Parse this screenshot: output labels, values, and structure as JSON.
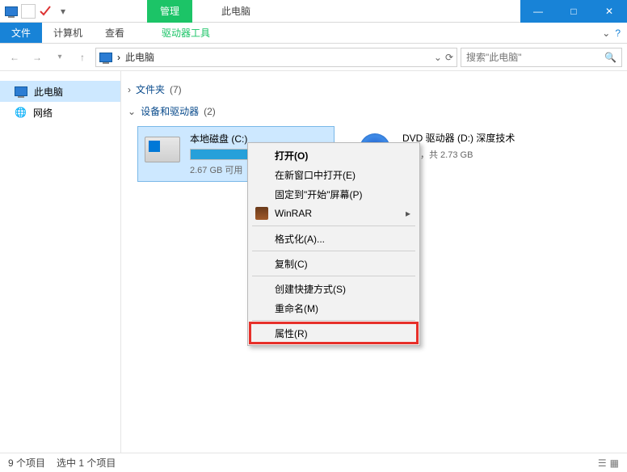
{
  "titlebar": {
    "context_tab": "管理",
    "title": "此电脑",
    "win_min": "—",
    "win_max": "□",
    "win_close": "✕"
  },
  "ribbon": {
    "file": "文件",
    "tab1": "计算机",
    "tab2": "查看",
    "ctx_tab": "驱动器工具"
  },
  "navbar": {
    "crumb_sep": "›",
    "crumb": "此电脑",
    "search_placeholder": "搜索\"此电脑\""
  },
  "sidebar": {
    "items": [
      {
        "label": "此电脑",
        "icon": "pc",
        "active": true
      },
      {
        "label": "网络",
        "icon": "net",
        "active": false
      }
    ]
  },
  "groups": {
    "folders": {
      "label": "文件夹",
      "count": "(7)"
    },
    "devices": {
      "label": "设备和驱动器",
      "count": "(2)"
    }
  },
  "drives": {
    "c": {
      "name": "本地磁盘 (C:)",
      "subtitle": "2.67 GB 可用",
      "fill_pct": 93
    },
    "d": {
      "name": "DVD 驱动器 (D:) 深度技术",
      "subtitle": "可用，共 2.73 GB"
    }
  },
  "context_menu": {
    "open": "打开(O)",
    "new_window": "在新窗口中打开(E)",
    "pin_start": "固定到\"开始\"屏幕(P)",
    "winrar": "WinRAR",
    "format": "格式化(A)...",
    "copy": "复制(C)",
    "create_shortcut": "创建快捷方式(S)",
    "rename": "重命名(M)",
    "properties": "属性(R)"
  },
  "statusbar": {
    "items": "9 个项目",
    "selected": "选中 1 个项目"
  }
}
